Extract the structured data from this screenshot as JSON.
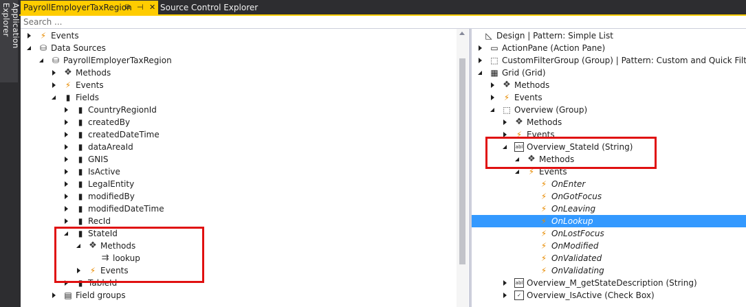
{
  "side_tab": {
    "label": "Application Explorer"
  },
  "tabs": [
    {
      "label": "PayrollEmployerTaxRegion",
      "pin": "⧉",
      "pin2": "⊣",
      "close": "✕"
    },
    {
      "label": "Source Control Explorer"
    }
  ],
  "search": {
    "placeholder": "Search ..."
  },
  "left_tree": [
    {
      "label": "Events",
      "icon": "events-icon",
      "expander": "collapsed"
    },
    {
      "label": "Data Sources",
      "icon": "database-icon",
      "expander": "expanded"
    },
    {
      "label": "PayrollEmployerTaxRegion",
      "icon": "database-icon",
      "expander": "expanded"
    },
    {
      "label": "Methods",
      "icon": "methods-icon",
      "expander": "collapsed"
    },
    {
      "label": "Events",
      "icon": "events-icon",
      "expander": "collapsed"
    },
    {
      "label": "Fields",
      "icon": "field-icon",
      "expander": "expanded"
    },
    {
      "label": "CountryRegionId",
      "icon": "field-icon",
      "expander": "collapsed"
    },
    {
      "label": "createdBy",
      "icon": "field-icon",
      "expander": "collapsed"
    },
    {
      "label": "createdDateTime",
      "icon": "field-icon",
      "expander": "collapsed"
    },
    {
      "label": "dataAreaId",
      "icon": "field-icon",
      "expander": "collapsed"
    },
    {
      "label": "GNIS",
      "icon": "field-icon",
      "expander": "collapsed"
    },
    {
      "label": "IsActive",
      "icon": "field-icon",
      "expander": "collapsed"
    },
    {
      "label": "LegalEntity",
      "icon": "field-icon",
      "expander": "collapsed"
    },
    {
      "label": "modifiedBy",
      "icon": "field-icon",
      "expander": "collapsed"
    },
    {
      "label": "modifiedDateTime",
      "icon": "field-icon",
      "expander": "collapsed"
    },
    {
      "label": "RecId",
      "icon": "field-icon",
      "expander": "collapsed"
    },
    {
      "label": "StateId",
      "icon": "field-icon",
      "expander": "expanded"
    },
    {
      "label": "Methods",
      "icon": "methods-icon",
      "expander": "expanded"
    },
    {
      "label": "lookup",
      "icon": "method-override-icon",
      "expander": "none"
    },
    {
      "label": "Events",
      "icon": "events-icon",
      "expander": "collapsed"
    },
    {
      "label": "TableId",
      "icon": "field-icon",
      "expander": "collapsed"
    },
    {
      "label": "Field groups",
      "icon": "field-groups-icon",
      "expander": "collapsed"
    }
  ],
  "right_tree": [
    {
      "label": "Design | Pattern: Simple List",
      "icon": "design-icon",
      "expander": "none"
    },
    {
      "label": "ActionPane (Action Pane)",
      "icon": "actionpane-icon",
      "expander": "collapsed"
    },
    {
      "label": "CustomFilterGroup (Group) | Pattern: Custom and Quick Filters",
      "icon": "group-icon",
      "expander": "collapsed"
    },
    {
      "label": "Grid (Grid)",
      "icon": "grid-icon",
      "expander": "expanded"
    },
    {
      "label": "Methods",
      "icon": "methods-icon",
      "expander": "collapsed"
    },
    {
      "label": "Events",
      "icon": "events-icon",
      "expander": "collapsed"
    },
    {
      "label": "Overview (Group)",
      "icon": "group-icon",
      "expander": "expanded"
    },
    {
      "label": "Methods",
      "icon": "methods-icon",
      "expander": "collapsed"
    },
    {
      "label": "Events",
      "icon": "events-icon",
      "expander": "collapsed"
    },
    {
      "label": "Overview_StateId (String)",
      "icon": "string-control-icon",
      "expander": "expanded"
    },
    {
      "label": "Methods",
      "icon": "methods-icon",
      "expander": "expanded"
    },
    {
      "label": "Events",
      "icon": "events-icon",
      "expander": "expanded"
    },
    {
      "label": "OnEnter",
      "icon": "event-handler-icon",
      "expander": "none"
    },
    {
      "label": "OnGotFocus",
      "icon": "event-handler-icon",
      "expander": "none"
    },
    {
      "label": "OnLeaving",
      "icon": "event-handler-icon",
      "expander": "none"
    },
    {
      "label": "OnLookup",
      "icon": "event-handler-icon",
      "expander": "none",
      "selected": true
    },
    {
      "label": "OnLostFocus",
      "icon": "event-handler-icon",
      "expander": "none"
    },
    {
      "label": "OnModified",
      "icon": "event-handler-icon",
      "expander": "none"
    },
    {
      "label": "OnValidated",
      "icon": "event-handler-icon",
      "expander": "none"
    },
    {
      "label": "OnValidating",
      "icon": "event-handler-icon",
      "expander": "none"
    },
    {
      "label": "Overview_M_getStateDescription (String)",
      "icon": "string-control-icon",
      "expander": "collapsed"
    },
    {
      "label": "Overview_IsActive (Check Box)",
      "icon": "checkbox-control-icon",
      "expander": "collapsed"
    }
  ],
  "colors": {
    "accent": "#ffcc00",
    "selection": "#3399ff",
    "annotation": "#e01010",
    "event_icon": "#e88b00"
  }
}
